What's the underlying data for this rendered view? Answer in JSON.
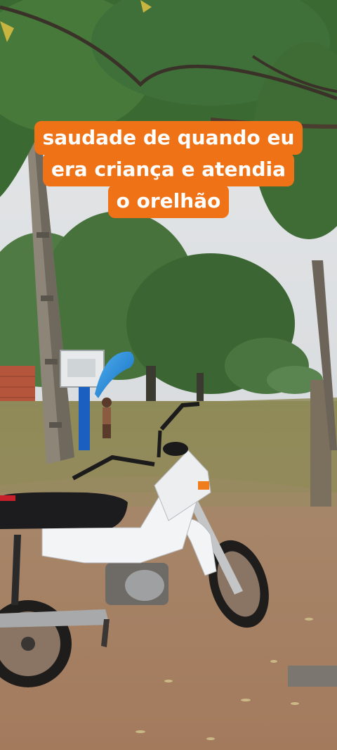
{
  "caption": {
    "lines": [
      "saudade de quando eu",
      "era criança e atendia",
      "o orelhão"
    ],
    "background_color": "#f07216",
    "text_color": "#ffffff"
  },
  "scene": {
    "colors": {
      "sky": "#dfe3e6",
      "foliage": "#3f6b34",
      "grass": "#8b8a55",
      "dirt": "#a57b5e",
      "payphone_hood": "#1e8fe0",
      "motorcycle_body": "#f3f4f6",
      "motorcycle_seat": "#1c1c1e"
    }
  }
}
